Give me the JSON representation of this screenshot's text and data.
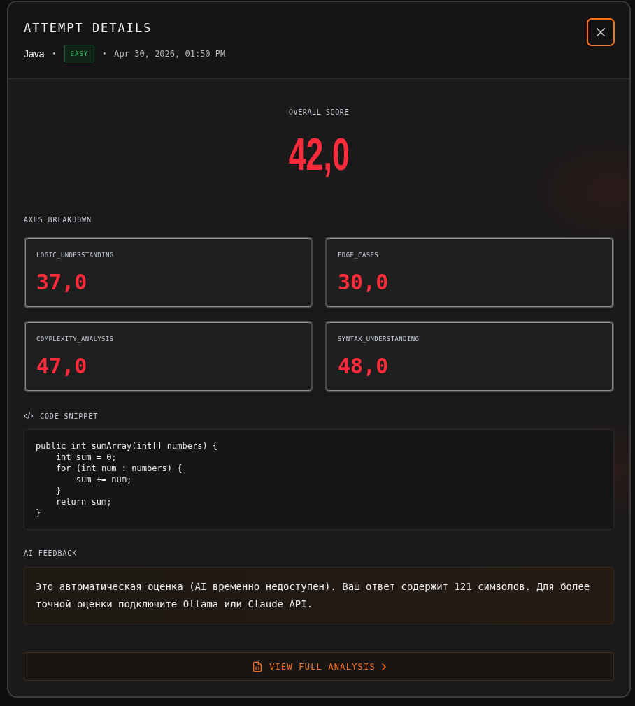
{
  "header": {
    "title": "ATTEMPT DETAILS",
    "meta": [
      {
        "kind": "language",
        "text": "Java"
      },
      {
        "kind": "separator",
        "text": "•"
      },
      {
        "kind": "badge",
        "text": "EASY"
      },
      {
        "kind": "separator",
        "text": "•"
      },
      {
        "kind": "date",
        "text": "Apr 30, 2026, 01:50 PM"
      }
    ]
  },
  "overall_score": {
    "label": "OVERALL SCORE",
    "value": "42,0"
  },
  "axes": {
    "title": "AXES BREAKDOWN",
    "items": [
      {
        "name": "LOGIC_UNDERSTANDING",
        "value": "37,0"
      },
      {
        "name": "EDGE_CASES",
        "value": "30,0"
      },
      {
        "name": "COMPLEXITY_ANALYSIS",
        "value": "47,0"
      },
      {
        "name": "SYNTAX_UNDERSTANDING",
        "value": "48,0"
      }
    ]
  },
  "code_snippet": {
    "title": "CODE SNIPPET",
    "lines": [
      "public int sumArray(int[] numbers) {",
      "    int sum = 0;",
      "    for (int num : numbers) {",
      "        sum += num;",
      "    }",
      "    return sum;",
      "}"
    ]
  },
  "ai_feedback": {
    "title": "AI FEEDBACK",
    "text": "Это автоматическая оценка (AI временно недоступен). Ваш ответ содержит 121 символов. Для более точной оценки подключите Ollama или Claude API."
  },
  "action": {
    "label": "VIEW FULL ANALYSIS"
  }
}
